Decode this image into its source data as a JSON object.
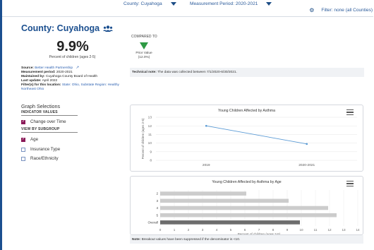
{
  "topbar": {
    "county_label": "County: Cuyahoga",
    "period_label": "Measurement Period: 2020-2021",
    "filter_label": "Filter: none (all Counties)"
  },
  "summary": {
    "title": "County: Cuyahoga",
    "value": "9.9%",
    "value_caption": "Percent of children (ages 2-5)",
    "source_key": "Source:",
    "source_value": "Better Health Partnership",
    "period_key": "Measurement period:",
    "period_value": "2020-2021",
    "maintained_key": "Maintained by:",
    "maintained_value": "Cuyahoga County Board of Health",
    "update_key": "Last update:",
    "update_value": "April 2022",
    "filters_key": "Filter(s) for this location:",
    "filters_value": "State: Ohio, Substate Region: Healthy Northeast Ohio"
  },
  "comparison": {
    "label": "COMPARED TO",
    "prior_label": "Prior Value",
    "prior_value": "(12.0%)",
    "direction_color": "#2e9a44"
  },
  "technote": {
    "key": "Technical note:",
    "text": "The data was collected between 7/1/2020-6/30/2021."
  },
  "graph_selections": {
    "title": "Graph Selections",
    "indicator_header": "INDICATOR VALUES",
    "indicator_options": [
      {
        "label": "Change over Time",
        "checked": true
      }
    ],
    "subgroup_header": "VIEW BY SUBGROUP",
    "subgroup_options": [
      {
        "label": "Age",
        "checked": true
      },
      {
        "label": "Insurance Type",
        "checked": false
      },
      {
        "label": "Race/Ethnicity",
        "checked": false
      }
    ]
  },
  "chart_data": [
    {
      "type": "line",
      "title": "Young Children Affected by Asthma",
      "ylabel": "Percent of children (ages 2-5)",
      "xlabel": "",
      "categories": [
        "2019",
        "2020-2021"
      ],
      "series": [
        {
          "values": [
            12.0,
            9.9
          ]
        }
      ],
      "ylim": [
        8,
        13
      ],
      "yticks": [
        8,
        9,
        10,
        11,
        12,
        13
      ],
      "grid": true,
      "color": "#5b9bd5"
    },
    {
      "type": "bar",
      "orientation": "horizontal",
      "title": "Young Children Affected by Asthma by Age",
      "xlabel": "Percent of children (ages 2-5)",
      "ylabel": "",
      "categories": [
        "2",
        "3",
        "4",
        "5",
        "Overall"
      ],
      "values": [
        6.1,
        9.1,
        11.9,
        12.5,
        9.9
      ],
      "xlim": [
        0,
        14
      ],
      "xticks": [
        0,
        1,
        2,
        3,
        4,
        5,
        6,
        7,
        8,
        9,
        10,
        11,
        12,
        13,
        14
      ],
      "grid": true,
      "colors": {
        "subgroup": "#cccccc",
        "overall": "#6d6d6d"
      }
    }
  ],
  "note": {
    "key": "Note:",
    "text": "Breakout values have been suppressed if the denominator is <10."
  }
}
